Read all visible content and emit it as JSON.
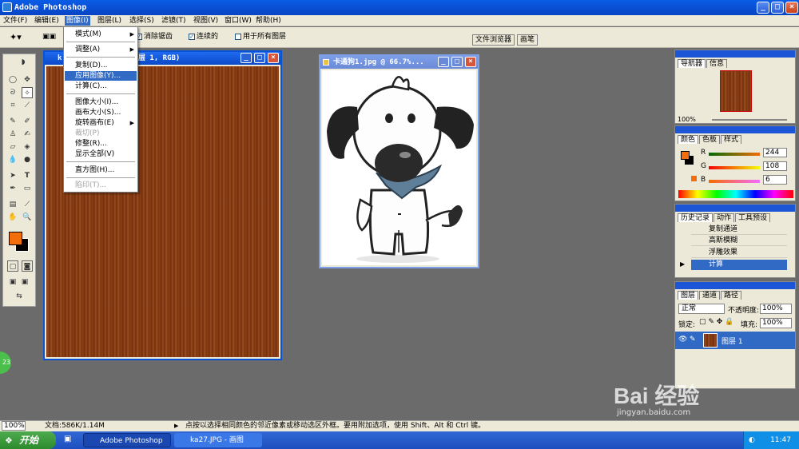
{
  "app": {
    "title": "Adobe Photoshop"
  },
  "menubar": [
    "文件(F)",
    "编辑(E)",
    "图像(I)",
    "图层(L)",
    "选择(S)",
    "滤镜(T)",
    "视图(V)",
    "窗口(W)",
    "帮助(H)"
  ],
  "options": {
    "anti_alias": "消除锯齿",
    "contiguous": "连续的",
    "all_layers": "用于所有图层",
    "tab_file_browser": "文件浏览器",
    "tab_brushes": "画笔"
  },
  "dropdown": {
    "items": [
      "模式(M)",
      "调整(A)",
      "复制(D)...",
      "应用图像(Y)...",
      "计算(C)...",
      "图像大小(I)...",
      "画布大小(S)...",
      "旋转画布(E)",
      "裁切(P)",
      "修整(R)...",
      "显示全部(V)",
      "直方图(H)...",
      "陷印(T)..."
    ],
    "selected_index": 3,
    "disabled": [
      "裁切(P)",
      "陷印(T)..."
    ]
  },
  "doc1": {
    "title": "k",
    "title_tail": "图层 1, RGB)"
  },
  "doc2": {
    "title": "卡通狗1.jpg @ 66.7%..."
  },
  "navigator": {
    "tab1": "导航器",
    "tab2": "信息",
    "zoom": "100%"
  },
  "color": {
    "tab1": "颜色",
    "tab2": "色板",
    "tab3": "样式",
    "r_label": "R",
    "g_label": "G",
    "b_label": "B",
    "r": "244",
    "g": "108",
    "b": "6",
    "fg": "#f26d0c"
  },
  "history": {
    "tab1": "历史记录",
    "tab2": "动作",
    "tab3": "工具预设",
    "items": [
      "复制通道",
      "高斯模糊",
      "浮雕效果",
      "计算"
    ]
  },
  "layers": {
    "tab1": "图层",
    "tab2": "通道",
    "tab3": "路径",
    "mode": "正常",
    "opacity_label": "不透明度:",
    "opacity": "100%",
    "lock_label": "锁定:",
    "fill_label": "填充:",
    "fill": "100%",
    "layer_name": "图层 1"
  },
  "status": {
    "zoom": "100%",
    "doc": "文档:586K/1.14M",
    "hint": "点按以选择相同颜色的邻近像素或移动选区外框。要用附加选项，使用 Shift、Alt 和 Ctrl 键。"
  },
  "taskbar": {
    "start": "开始",
    "task1": "Adobe Photoshop",
    "task2": "ka27.JPG - 画图",
    "clock": "11:47"
  },
  "watermark": {
    "brand": "Bai 经验",
    "url": "jingyan.baidu.com"
  },
  "side_badge": "23"
}
